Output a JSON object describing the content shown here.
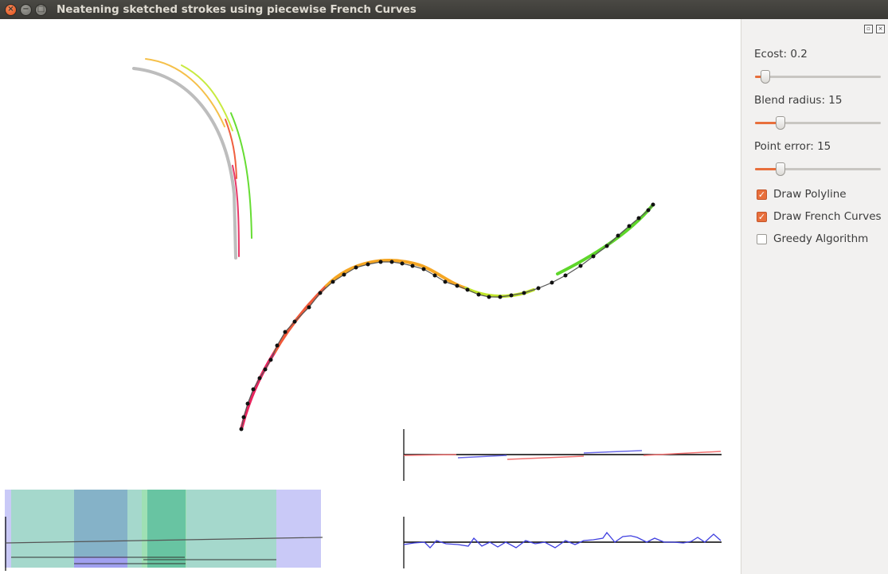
{
  "window": {
    "title": "Neatening sketched strokes using piecewise French Curves",
    "close_glyph": "×",
    "minimize_glyph": "−",
    "maximize_glyph": "□"
  },
  "dock": {
    "float_glyph": "▫",
    "close_glyph": "×"
  },
  "controls": {
    "ecost": {
      "label": "Ecost: 0.2",
      "level": 0.05
    },
    "blend_radius": {
      "label": "Blend radius: 15",
      "level": 0.18
    },
    "point_error": {
      "label": "Point error: 15",
      "level": 0.18
    },
    "draw_polyline": {
      "label": "Draw Polyline",
      "checked": true
    },
    "draw_french_curves": {
      "label": "Draw French Curves",
      "checked": true
    },
    "greedy_algorithm": {
      "label": "Greedy Algorithm",
      "checked": false
    }
  },
  "colors": {
    "accent": "#e86f3c",
    "segment_pink": "#e8245e",
    "segment_red": "#f05a3a",
    "segment_orange": "#f5a623",
    "segment_yellow": "#f2d32a",
    "segment_lime": "#b8e62a",
    "segment_green": "#5ed62a",
    "curvature_red": "#f07070",
    "curvature_blue": "#6a6ae8",
    "panel_background": "#f2f1f0"
  },
  "icons": {
    "close": "close-icon",
    "minimize": "minimize-icon",
    "maximize": "maximize-icon",
    "checkmark": "checkmark-icon"
  }
}
